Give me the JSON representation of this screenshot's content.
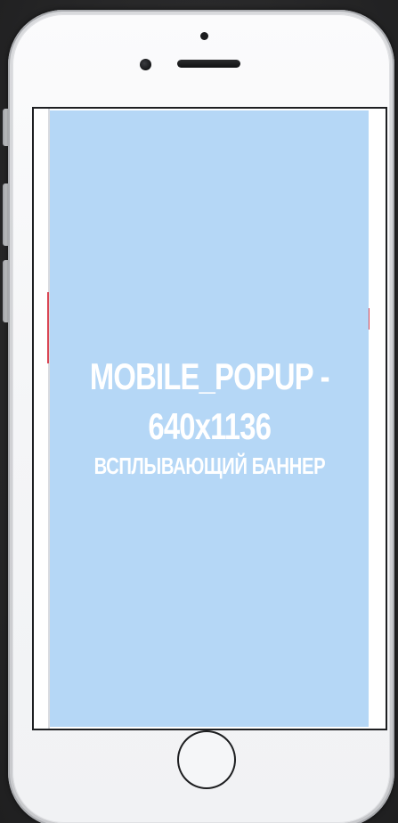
{
  "device": {
    "model": "smartphone-mockup"
  },
  "popup": {
    "title": "MOBILE_POPUP -",
    "size": "640x1136",
    "subtitle": "ВСПЛЫВАЮЩИЙ БАННЕР",
    "background_color": "#b5d7f6",
    "text_color": "#ffffff"
  },
  "colors": {
    "phone_body": "#f4f5f7",
    "screen_bezel": "#1e1f22",
    "accent_red": "#d94654",
    "backdrop": "#2a2a2b"
  }
}
